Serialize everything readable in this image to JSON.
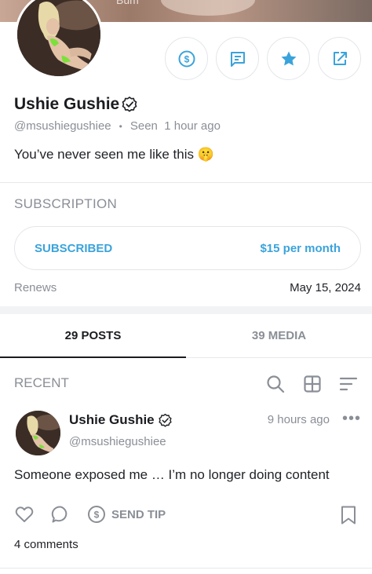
{
  "cover": {
    "text": "Bum"
  },
  "profile": {
    "name": "Ushie Gushie",
    "handle": "@msushiegushiee",
    "seen_separator": "•",
    "seen": "Seen  1 hour ago",
    "bio": "You’ve never seen me like this 🤫"
  },
  "actions": [
    {
      "icon": "dollar-circle-icon"
    },
    {
      "icon": "message-icon"
    },
    {
      "icon": "star-icon"
    },
    {
      "icon": "share-icon"
    }
  ],
  "subscription": {
    "title": "SUBSCRIPTION",
    "status": "SUBSCRIBED",
    "price": "$15 per month",
    "renews_label": "Renews",
    "renews_date": "May 15, 2024"
  },
  "tabs": [
    {
      "label": "29 POSTS",
      "active": true
    },
    {
      "label": "39 MEDIA",
      "active": false
    }
  ],
  "recent": {
    "title": "RECENT",
    "tools": [
      "search-icon",
      "grid-icon",
      "sort-icon"
    ]
  },
  "post": {
    "name": "Ushie Gushie",
    "handle": "@msushiegushiee",
    "time": "9 hours ago",
    "more": "•••",
    "text": "Someone exposed me … I’m no longer doing content",
    "send_tip": "SEND TIP",
    "comments": "4 comments"
  },
  "colors": {
    "accent": "#3aa3db",
    "muted": "#8a8e96",
    "text": "#1f2126",
    "border": "#e3e6ea"
  }
}
